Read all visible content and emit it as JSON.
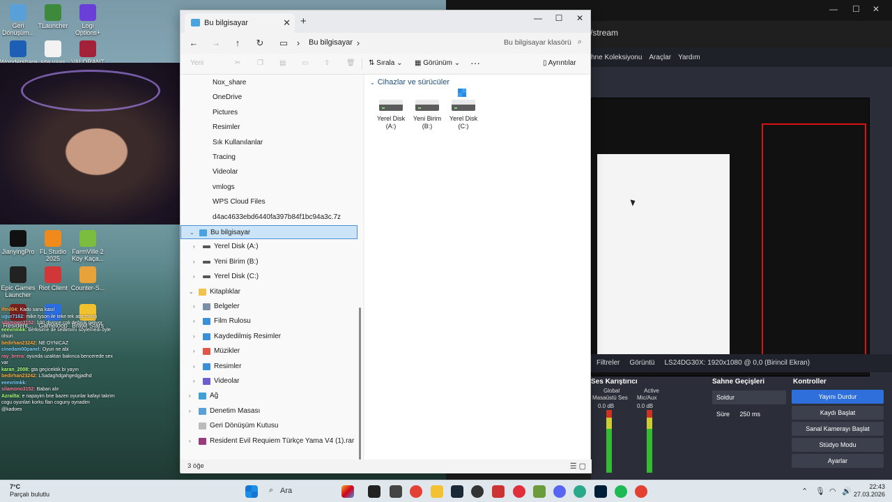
{
  "desktop": {
    "icons": [
      {
        "label": "Geri Dönüşüm..."
      },
      {
        "label": "TLauncher"
      },
      {
        "label": "Logi Options+"
      },
      {
        "label": "Wondershare..."
      },
      {
        "label": "site yaas"
      },
      {
        "label": "VALORANT"
      },
      {
        "label": "JianyingPro"
      },
      {
        "label": "FL Studio 2025"
      },
      {
        "label": "FarmVille 2 Köy Kaça..."
      },
      {
        "label": "Epic Games Launcher"
      },
      {
        "label": "Riot Client"
      },
      {
        "label": "Counter-S..."
      },
      {
        "label": "Resident..."
      },
      {
        "label": "Gameloop"
      },
      {
        "label": "Brawl Stars"
      }
    ]
  },
  "chat": {
    "messages": [
      {
        "user": "lfinil04:",
        "text": "Kado sana kasıl"
      },
      {
        "user": "ugur7162:",
        "text": "mike tyson ile teke tek atar mısın"
      },
      {
        "user": "silamono3152:",
        "text": "100 diyince cok değişik geliyor"
      },
      {
        "user": "eeevrimkk:",
        "text": "berkisime de selamımı söylemedi öyle olsun"
      },
      {
        "user": "bedirhan23242:",
        "text": "NE OYNICAZ"
      },
      {
        "user": "cinedam00panel:",
        "text": "Oyun ne abi"
      },
      {
        "user": "ray_brera:",
        "text": "oyunda uzaktan bakınca bencerede sex var"
      },
      {
        "user": "karan_2008:",
        "text": "gta geçicektik bi yayın"
      },
      {
        "user": "bedirhan23242:",
        "text": "LSadaghdgahgedgjadhd"
      },
      {
        "user": "eeevrimkk:",
        "text": ""
      },
      {
        "user": "silamono3152:",
        "text": "Baban alır"
      },
      {
        "user": "Azrailta:",
        "text": "e napayim bne bazen oyunlar kafayi takrim cogu oyunlari korku flan coguny oynadim"
      },
      {
        "user": "",
        "text": "@kadoex"
      }
    ]
  },
  "browser": {
    "url": "/stream",
    "obs_menu": [
      "hne Koleksiyonu",
      "Araçlar",
      "Yardım"
    ]
  },
  "obs": {
    "source_bar": {
      "filters": "Filtreler",
      "display": "Görüntü",
      "display_value": "LS24DG30X: 1920x1080 @ 0,0 (Birincil Ekran)"
    },
    "mixer_title": "Ses Karıştırıcı",
    "mixer_tabs": [
      "Global",
      "Active"
    ],
    "mixer_channels": [
      {
        "name": "Masaüstü Ses",
        "db": "0.0 dB"
      },
      {
        "name": "Mic/Aux",
        "db": "0.0 dB"
      }
    ],
    "scene_trans_title": "Sahne Geçişleri",
    "transition": "Soldur",
    "duration_label": "Süre",
    "duration_value": "250 ms",
    "controls_title": "Kontroller",
    "controls": [
      "Yayını Durdur",
      "Kaydı Başlat",
      "Sanal Kamerayı Başlat",
      "Stüdyo Modu",
      "Ayarlar"
    ]
  },
  "explorer": {
    "tab_title": "Bu bilgisayar",
    "breadcrumb": "Bu bilgisayar",
    "search_placeholder": "Bu bilgisayar klasörü",
    "cmd": {
      "new": "Yeni",
      "sort": "Sırala",
      "view": "Görünüm",
      "more": "···",
      "preview": "Ayrıntılar"
    },
    "tree": [
      {
        "label": "Nox_share",
        "indent": 0,
        "icon": "folder"
      },
      {
        "label": "OneDrive",
        "indent": 0,
        "icon": "folder"
      },
      {
        "label": "Pictures",
        "indent": 0,
        "icon": "folder"
      },
      {
        "label": "Resimler",
        "indent": 0,
        "icon": "folder"
      },
      {
        "label": "Sık Kullanılanlar",
        "indent": 0,
        "icon": "folder"
      },
      {
        "label": "Tracing",
        "indent": 0,
        "icon": "folder"
      },
      {
        "label": "Videolar",
        "indent": 0,
        "icon": "folder"
      },
      {
        "label": "vmlogs",
        "indent": 0,
        "icon": "folder"
      },
      {
        "label": "WPS Cloud Files",
        "indent": 0,
        "icon": "folder"
      },
      {
        "label": "d4ac4633ebd6440fa397b84f1bc94a3c.7z",
        "indent": 0,
        "icon": "file"
      },
      {
        "label": "Bu bilgisayar",
        "indent": 1,
        "icon": "pc",
        "expanded": true,
        "selected": true
      },
      {
        "label": "Yerel Disk (A:)",
        "indent": 2,
        "icon": "drive"
      },
      {
        "label": "Yeni Birim (B:)",
        "indent": 2,
        "icon": "drive"
      },
      {
        "label": "Yerel Disk (C:)",
        "indent": 2,
        "icon": "drive"
      },
      {
        "label": "Kitaplıklar",
        "indent": 1,
        "icon": "folder",
        "expanded": true
      },
      {
        "label": "Belgeler",
        "indent": 2,
        "icon": "doc"
      },
      {
        "label": "Film Rulosu",
        "indent": 2,
        "icon": "pic"
      },
      {
        "label": "Kaydedilmiş Resimler",
        "indent": 2,
        "icon": "pic"
      },
      {
        "label": "Müzikler",
        "indent": 2,
        "icon": "music"
      },
      {
        "label": "Resimler",
        "indent": 2,
        "icon": "pic"
      },
      {
        "label": "Videolar",
        "indent": 2,
        "icon": "video"
      },
      {
        "label": "Ağ",
        "indent": 1,
        "icon": "net"
      },
      {
        "label": "Denetim Masası",
        "indent": 1,
        "icon": "cp"
      },
      {
        "label": "Geri Dönüşüm Kutusu",
        "indent": 1,
        "icon": "bin",
        "nochev": true
      },
      {
        "label": "Resident Evil Requiem Türkçe Yama V4 (1).rar",
        "indent": 1,
        "icon": "rar"
      }
    ],
    "group_header": "Cihazlar ve sürücüler",
    "drives": [
      {
        "line1": "Yerel Disk",
        "line2": "(A:)",
        "windows": false
      },
      {
        "line1": "Yeni Birim",
        "line2": "(B:)",
        "windows": false
      },
      {
        "line1": "Yerel Disk",
        "line2": "(C:)",
        "windows": true
      }
    ],
    "status": "3 öğe"
  },
  "taskbar": {
    "weather_temp": "7°C",
    "weather_desc": "Parçalı bulutlu",
    "search": "Ara",
    "time": "22:43",
    "date": "27.03.2026"
  }
}
